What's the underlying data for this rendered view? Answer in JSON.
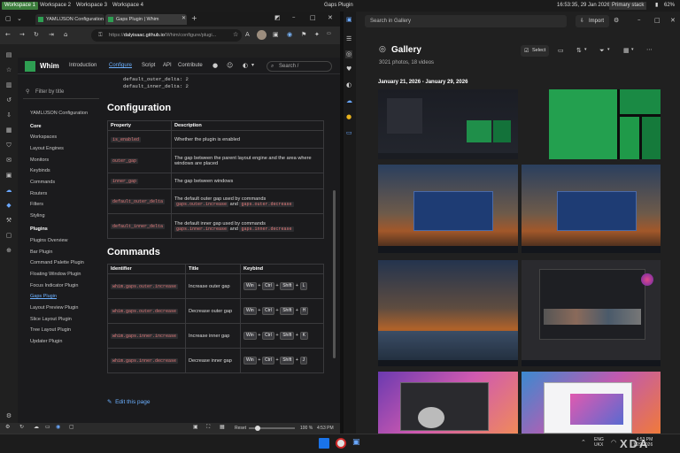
{
  "topbar": {
    "workspaces": [
      "Workspace 1",
      "Workspace 2",
      "Workspace 3",
      "Workspace 4"
    ],
    "center_title": "Gaps Plugin",
    "clock": "16:53:35, 29 Jan 2026",
    "stack": "Primary stack",
    "battery": "62%"
  },
  "browser": {
    "tabs": [
      "YAML/JSON Configuration",
      "Gaps Plugin | Whim"
    ],
    "url_host": "dalyisaac.github.io",
    "url_path": "/Whim/configure/plugi...",
    "url_prefix": "https://",
    "zoom": "100 %",
    "reset": "Reset",
    "time": "4:53 PM"
  },
  "site": {
    "logo": "Whim",
    "nav": [
      "Introduction",
      "Configure",
      "Script",
      "API",
      "Contribute"
    ],
    "search_placeholder": "Search /",
    "filter_placeholder": "Filter by title",
    "sidebar": {
      "top": "YAML/JSON Configuration",
      "core_heading": "Core",
      "core": [
        "Workspaces",
        "Layout Engines",
        "Monitors",
        "Keybinds",
        "Commands",
        "Routers",
        "Filters",
        "Styling"
      ],
      "plugins_heading": "Plugins",
      "plugins": [
        "Plugins Overview",
        "Bar Plugin",
        "Command Palette Plugin",
        "Floating Window Plugin",
        "Focus Indicator Plugin",
        "Gaps Plugin",
        "Layout Preview Plugin",
        "Slice Layout Plugin",
        "Tree Layout Plugin",
        "Updater Plugin"
      ]
    },
    "code_lines": [
      "default_outer_delta: 2",
      "default_inner_delta: 2"
    ],
    "config_heading": "Configuration",
    "config_headers": [
      "Property",
      "Description"
    ],
    "config_rows": [
      {
        "prop": "is_enabled",
        "desc": "Whether the plugin is enabled"
      },
      {
        "prop": "outer_gap",
        "desc": "The gap between the parent layout engine and the area where windows are placed"
      },
      {
        "prop": "inner_gap",
        "desc": "The gap between windows"
      },
      {
        "prop": "default_outer_delta",
        "desc1": "The default outer gap used by commands",
        "c1": "gaps.outer.increase",
        "and": "and",
        "c2": "gaps.outer.decrease"
      },
      {
        "prop": "default_inner_delta",
        "desc1": "The default inner gap used by commands",
        "c1": "gaps.inner.increase",
        "and": "and",
        "c2": "gaps.inner.decrease"
      }
    ],
    "commands_heading": "Commands",
    "commands_headers": [
      "Identifier",
      "Title",
      "Keybind"
    ],
    "commands_rows": [
      {
        "id": "whim.gaps.outer.increase",
        "title": "Increase outer gap",
        "keys": [
          "Win",
          "Ctrl",
          "Shift",
          "L"
        ]
      },
      {
        "id": "whim.gaps.outer.decrease",
        "title": "Decrease outer gap",
        "keys": [
          "Win",
          "Ctrl",
          "Shift",
          "H"
        ]
      },
      {
        "id": "whim.gaps.inner.increase",
        "title": "Increase inner gap",
        "keys": [
          "Win",
          "Ctrl",
          "Shift",
          "K"
        ]
      },
      {
        "id": "whim.gaps.inner.decrease",
        "title": "Decrease inner gap",
        "keys": [
          "Win",
          "Ctrl",
          "Shift",
          "J"
        ]
      }
    ],
    "plus": "+",
    "edit_link": "Edit this page"
  },
  "gallery": {
    "search_placeholder": "Search in Gallery",
    "import": "Import",
    "title": "Gallery",
    "count": "3021 photos, 18 videos",
    "select": "Select",
    "date_range": "January 21, 2026 - January 29, 2026"
  },
  "taskbar": {
    "lang1": "ENG",
    "lang2": "UKX",
    "time": "4:53 PM",
    "date": "1/29/2026"
  },
  "watermark": "XDA",
  "colors": {
    "accent_link": "#6cb0ff",
    "workspace_active": "#3c7d3c",
    "code_text": "#e07a7a"
  }
}
